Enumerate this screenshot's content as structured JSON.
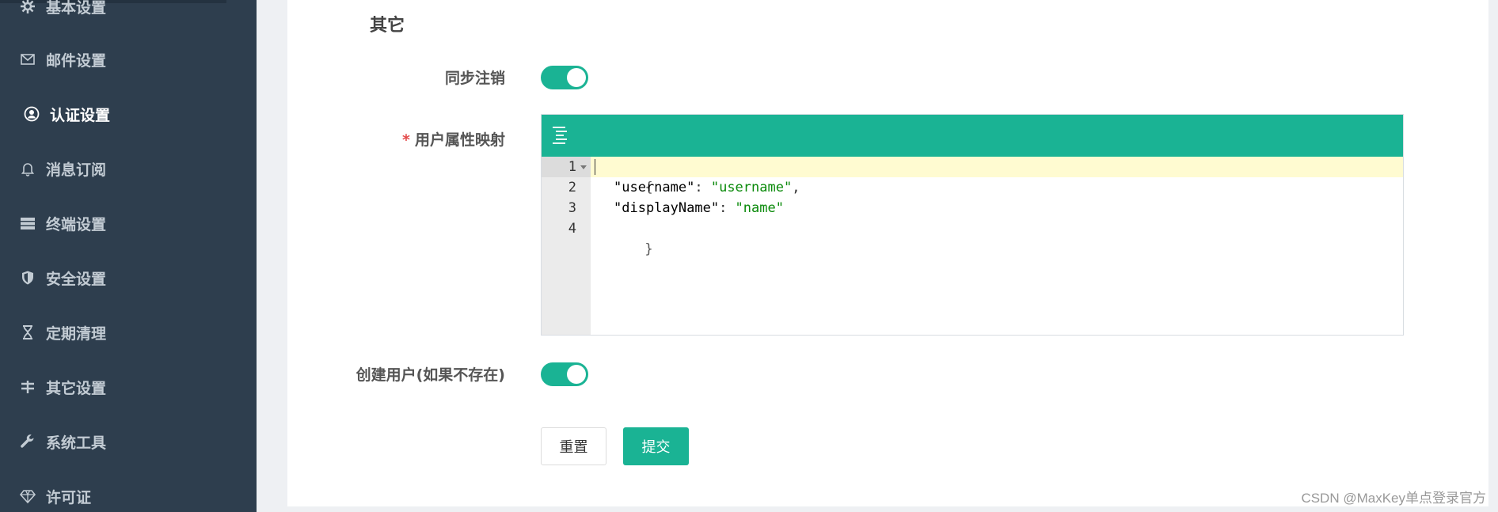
{
  "sidebar": {
    "items": [
      {
        "label": "基本设置",
        "icon": "gear-icon",
        "active": false
      },
      {
        "label": "邮件设置",
        "icon": "mail-icon",
        "active": false
      },
      {
        "label": "认证设置",
        "icon": "user-circle-icon",
        "active": true
      },
      {
        "label": "消息订阅",
        "icon": "bell-icon",
        "active": false
      },
      {
        "label": "终端设置",
        "icon": "server-icon",
        "active": false
      },
      {
        "label": "安全设置",
        "icon": "shield-icon",
        "active": false
      },
      {
        "label": "定期清理",
        "icon": "hourglass-icon",
        "active": false
      },
      {
        "label": "其它设置",
        "icon": "sliders-icon",
        "active": false
      },
      {
        "label": "系统工具",
        "icon": "wrench-icon",
        "active": false
      },
      {
        "label": "许可证",
        "icon": "diamond-icon",
        "active": false
      }
    ]
  },
  "form": {
    "section_title": "其它",
    "sync_logout_label": "同步注销",
    "sync_logout_on": true,
    "attr_mapping_required_mark": "*",
    "attr_mapping_label": "用户属性映射",
    "create_user_label": "创建用户(如果不存在)",
    "create_user_on": true
  },
  "editor": {
    "lines": [
      "1",
      "2",
      "3",
      "4"
    ],
    "code": {
      "l1": "{",
      "l2_key": "\"username\"",
      "l2_colon": ": ",
      "l2_val": "\"username\"",
      "l2_comma": ",",
      "l3_key": "\"displayName\"",
      "l3_colon": ": ",
      "l3_val": "\"name\"",
      "l4": "}"
    }
  },
  "buttons": {
    "reset": "重置",
    "submit": "提交"
  },
  "watermark": "CSDN @MaxKey单点登录官方",
  "colors": {
    "sidebar_bg": "#2e3e4e",
    "accent": "#1ab394"
  }
}
